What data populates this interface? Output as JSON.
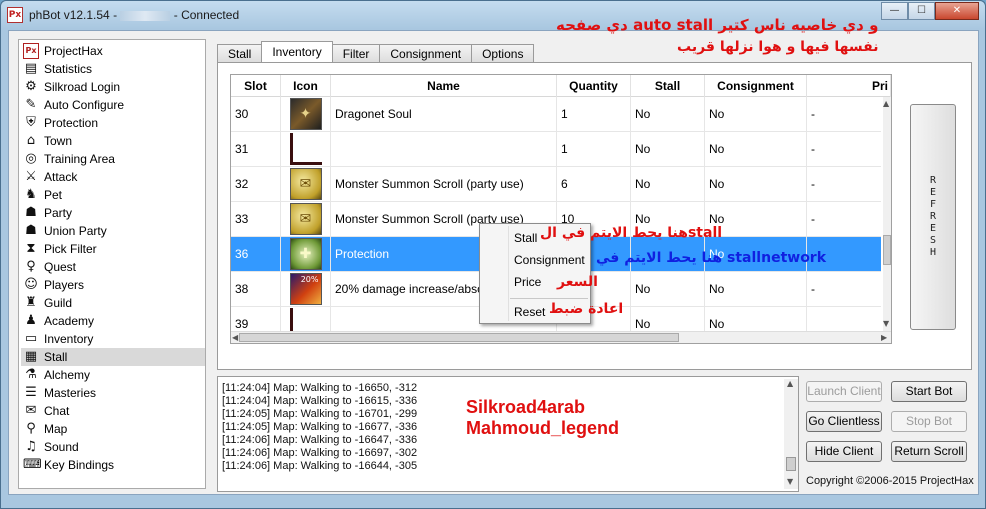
{
  "window": {
    "title_prefix": "phBot v12.1.54 - ",
    "title_suffix": " - Connected",
    "app_icon": "Px",
    "minimize": "—",
    "maximize": "☐",
    "close": "✕"
  },
  "sidebar": {
    "items": [
      {
        "label": "ProjectHax",
        "icon": "Px"
      },
      {
        "label": "Statistics",
        "icon": "▤"
      },
      {
        "label": "Silkroad Login",
        "icon": "⚙"
      },
      {
        "label": "Auto Configure",
        "icon": "✎"
      },
      {
        "label": "Protection",
        "icon": "⛨"
      },
      {
        "label": "Town",
        "icon": "⌂"
      },
      {
        "label": "Training Area",
        "icon": "◎"
      },
      {
        "label": "Attack",
        "icon": "⚔"
      },
      {
        "label": "Pet",
        "icon": "♞"
      },
      {
        "label": "Party",
        "icon": "☗"
      },
      {
        "label": "Union Party",
        "icon": "☗"
      },
      {
        "label": "Pick Filter",
        "icon": "⧗"
      },
      {
        "label": "Quest",
        "icon": "♀"
      },
      {
        "label": "Players",
        "icon": "☺"
      },
      {
        "label": "Guild",
        "icon": "♜"
      },
      {
        "label": "Academy",
        "icon": "♟"
      },
      {
        "label": "Inventory",
        "icon": "▭"
      },
      {
        "label": "Stall",
        "icon": "▦"
      },
      {
        "label": "Alchemy",
        "icon": "⚗"
      },
      {
        "label": "Masteries",
        "icon": "☰"
      },
      {
        "label": "Chat",
        "icon": "✉"
      },
      {
        "label": "Map",
        "icon": "⚲"
      },
      {
        "label": "Sound",
        "icon": "♫"
      },
      {
        "label": "Key Bindings",
        "icon": "⌨"
      }
    ]
  },
  "tabs": [
    "Stall",
    "Inventory",
    "Filter",
    "Consignment",
    "Options"
  ],
  "grid": {
    "headers": [
      "Slot",
      "Icon",
      "Name",
      "Quantity",
      "Stall",
      "Consignment",
      "Pri"
    ],
    "rows": [
      {
        "slot": "30",
        "icon": "dragonet-soul-icon",
        "name": "Dragonet Soul",
        "quantity": "1",
        "stall": "No",
        "consignment": "No",
        "price": "-"
      },
      {
        "slot": "31",
        "icon": "empty-slot-icon",
        "name": "",
        "quantity": "1",
        "stall": "No",
        "consignment": "No",
        "price": "-"
      },
      {
        "slot": "32",
        "icon": "scroll-icon",
        "name": "Monster Summon Scroll (party use)",
        "quantity": "6",
        "stall": "No",
        "consignment": "No",
        "price": "-"
      },
      {
        "slot": "33",
        "icon": "scroll-icon",
        "name": "Monster Summon Scroll (party use)",
        "quantity": "10",
        "stall": "No",
        "consignment": "No",
        "price": "-"
      },
      {
        "slot": "36",
        "icon": "protection-icon",
        "name": "Protection",
        "quantity": "",
        "stall": "",
        "consignment": "No",
        "price": "-"
      },
      {
        "slot": "38",
        "icon": "damage-increase-icon",
        "name": "20% damage increase/absor",
        "quantity": "",
        "stall": "No",
        "consignment": "No",
        "price": "-"
      },
      {
        "slot": "39",
        "icon": "empty-slot-icon",
        "name": "",
        "quantity": "",
        "stall": "No",
        "consignment": "No",
        "price": ""
      }
    ],
    "dmg_badge": "20%"
  },
  "context_menu": {
    "items": [
      "Stall",
      "Consignment",
      "Price",
      "Reset"
    ]
  },
  "refresh_label": "REFRESH",
  "log": {
    "lines": [
      "[11:24:04] Map: Walking to -16650, -312",
      "[11:24:04] Map: Walking to -16615, -336",
      "[11:24:05] Map: Walking to -16701, -299",
      "[11:24:05] Map: Walking to -16677, -336",
      "[11:24:06] Map: Walking to -16647, -336",
      "[11:24:06] Map: Walking to -16697, -302",
      "[11:24:06] Map: Walking to -16644, -305"
    ]
  },
  "buttons": {
    "launch_client": "Launch Client",
    "start_bot": "Start Bot",
    "go_clientless": "Go Clientless",
    "stop_bot": "Stop Bot",
    "hide_client": "Hide Client",
    "return_scroll": "Return Scroll"
  },
  "copyright": "Copyright ©2006-2015 ProjectHax",
  "annotations": {
    "top_line1": "دي صفحه auto stall و دي خاصيه ناس كتير",
    "top_line2": "نفسها فيها و هوا نزلها قريب",
    "stall": "هنا يحط الايتم في الstall",
    "stallnetwork": "هنا يحط الايتم في stallnetwork",
    "price": "السعر",
    "reset": "اعادة ضبط",
    "credit1": "Silkroad4arab",
    "credit2": "Mahmoud_legend"
  },
  "colors": {
    "selection": "#3399ff",
    "annotation_red": "#e01010",
    "annotation_blue": "#1020e0"
  }
}
